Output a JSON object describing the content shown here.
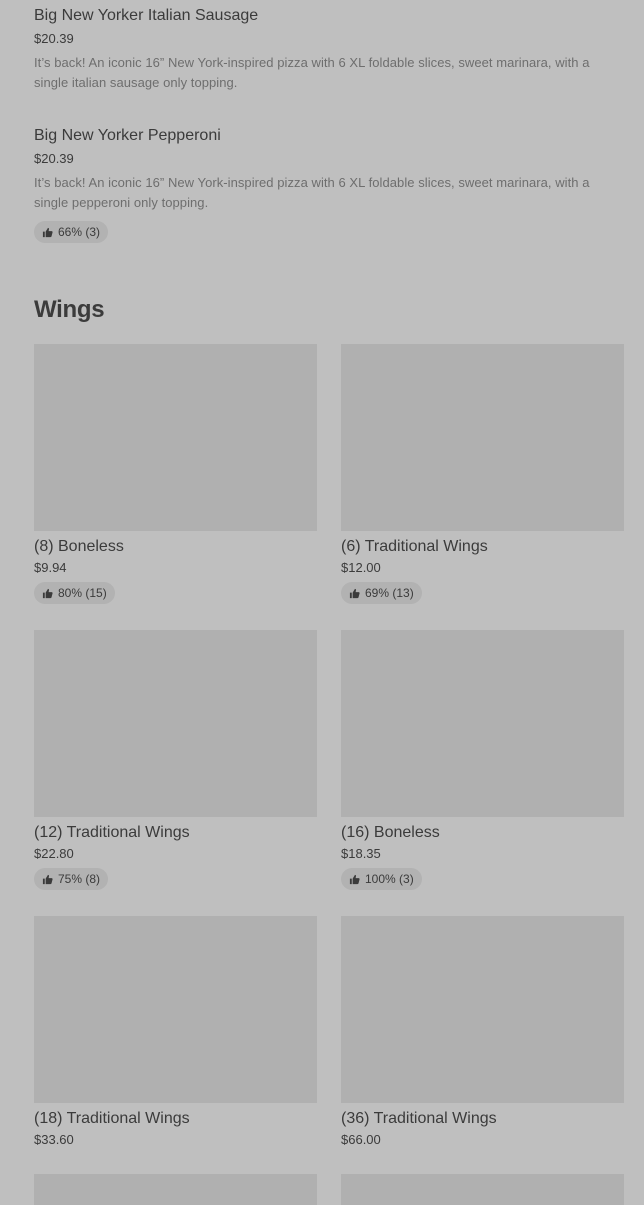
{
  "list_items": [
    {
      "name": "Big New Yorker Italian Sausage",
      "price": "$20.39",
      "description": "It’s back! An iconic 16” New York-inspired pizza with 6 XL foldable slices, sweet marinara, with a single italian sausage only topping."
    },
    {
      "name": "Big New Yorker Pepperoni",
      "price": "$20.39",
      "description": "It’s back! An iconic 16” New York-inspired pizza with 6 XL foldable slices, sweet marinara, with a single pepperoni only topping.",
      "rating": "66% (3)"
    }
  ],
  "section": {
    "title": "Wings"
  },
  "cards": [
    {
      "name": "(8) Boneless",
      "price": "$9.94",
      "rating": "80% (15)"
    },
    {
      "name": "(6) Traditional Wings",
      "price": "$12.00",
      "rating": "69% (13)"
    },
    {
      "name": "(12) Traditional Wings",
      "price": "$22.80",
      "rating": "75% (8)"
    },
    {
      "name": "(16) Boneless",
      "price": "$18.35",
      "rating": "100% (3)"
    },
    {
      "name": "(18) Traditional Wings",
      "price": "$33.60"
    },
    {
      "name": "(36) Traditional Wings",
      "price": "$66.00"
    }
  ],
  "icons": {
    "rating_icon": "thumbs-up-icon"
  },
  "colors": {
    "background": "#bfbfbf",
    "image_placeholder": "#b0b0b0",
    "badge": "#b2b2b2"
  }
}
